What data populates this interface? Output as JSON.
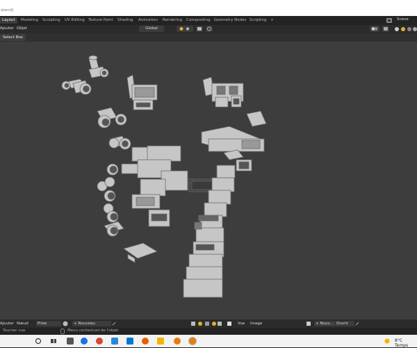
{
  "window": {
    "title": ".blend]"
  },
  "tabs": [
    {
      "label": "Layout",
      "active": true
    },
    {
      "label": "Modeling"
    },
    {
      "label": "Sculpting"
    },
    {
      "label": "UV Editing"
    },
    {
      "label": "Texture Paint"
    },
    {
      "label": "Shading"
    },
    {
      "label": "Animation"
    },
    {
      "label": "Rendering"
    },
    {
      "label": "Compositing"
    },
    {
      "label": "Geometry Nodes"
    },
    {
      "label": "Scripting"
    },
    {
      "label": "+"
    }
  ],
  "scene": {
    "label": "Scene"
  },
  "header": {
    "menu_add": "Ajouter",
    "menu_object": "Objet",
    "transform_orientation": "Global"
  },
  "subheader": {
    "tool_label": "Select Box"
  },
  "bottom": {
    "menu_add": "Ajouter",
    "menu_node": "Nœud",
    "take_field": "Prise",
    "new_button": "+ Nouveau",
    "menu_view": "Vue",
    "menu_image": "Image",
    "new_image_button": "+ Nouv...",
    "open_button": "Ouvrir"
  },
  "status": {
    "rotate_view": "Tourner vue",
    "context_menu": "Menu contextuel de l'objet"
  },
  "taskbar": {
    "weather": "8°C  Temps"
  },
  "colors": {
    "viewport_bg": "#3d3d3d",
    "accent": "#e8a060",
    "mesh": "#c8c8c8"
  }
}
